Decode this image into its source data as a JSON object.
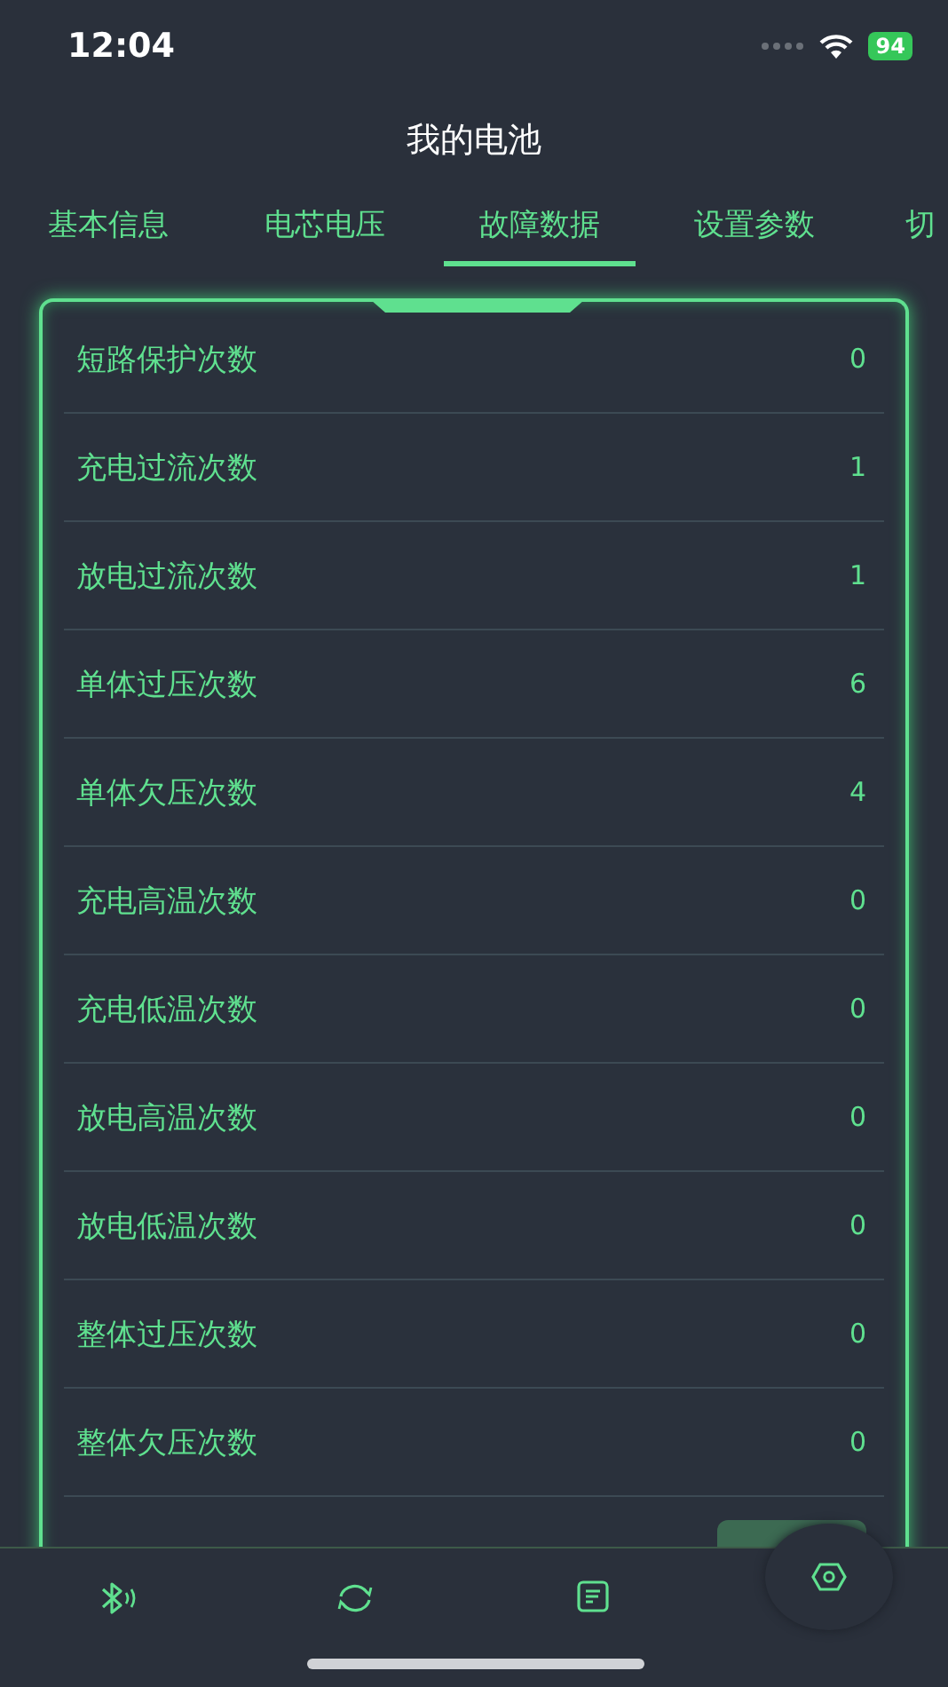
{
  "status_bar": {
    "time": "12:04",
    "battery": "94"
  },
  "title": "我的电池",
  "tabs": [
    {
      "label": "基本信息",
      "selected": false
    },
    {
      "label": "电芯电压",
      "selected": false
    },
    {
      "label": "故障数据",
      "selected": true
    },
    {
      "label": "设置参数",
      "selected": false
    },
    {
      "label": "切",
      "selected": false
    }
  ],
  "rows": [
    {
      "label": "短路保护次数",
      "value": "0"
    },
    {
      "label": "充电过流次数",
      "value": "1"
    },
    {
      "label": "放电过流次数",
      "value": "1"
    },
    {
      "label": "单体过压次数",
      "value": "6"
    },
    {
      "label": "单体欠压次数",
      "value": "4"
    },
    {
      "label": "充电高温次数",
      "value": "0"
    },
    {
      "label": "充电低温次数",
      "value": "0"
    },
    {
      "label": "放电高温次数",
      "value": "0"
    },
    {
      "label": "放电低温次数",
      "value": "0"
    },
    {
      "label": "整体过压次数",
      "value": "0"
    },
    {
      "label": "整体欠压次数",
      "value": "0"
    }
  ],
  "nav": [
    {
      "kind": "bluetooth"
    },
    {
      "kind": "refresh"
    },
    {
      "kind": "document"
    },
    {
      "kind": "settings"
    }
  ]
}
